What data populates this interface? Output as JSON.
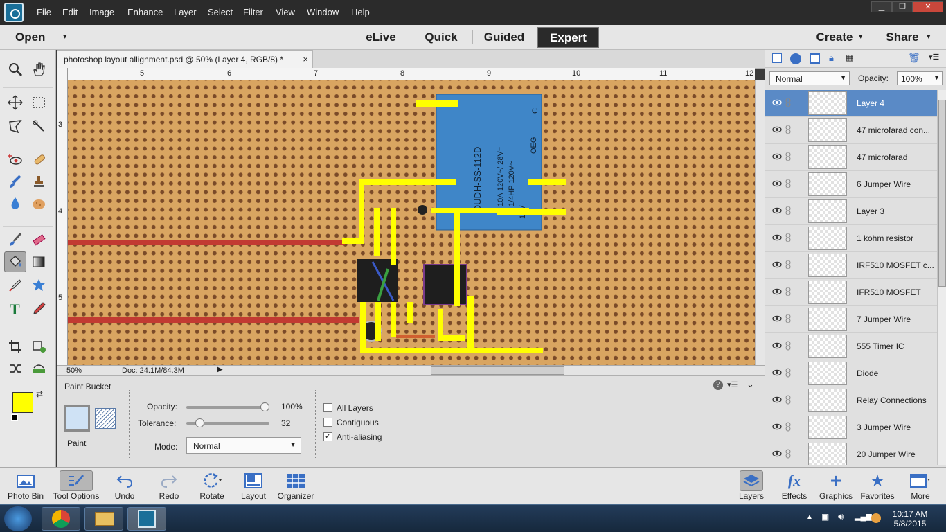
{
  "menubar": {
    "items": [
      "File",
      "Edit",
      "Image",
      "Enhance",
      "Layer",
      "Select",
      "Filter",
      "View",
      "Window",
      "Help"
    ]
  },
  "modebar": {
    "open": "Open",
    "modes": [
      "eLive",
      "Quick",
      "Guided",
      "Expert"
    ],
    "create": "Create",
    "share": "Share"
  },
  "document": {
    "tab_title": "photoshop layout allignment.psd @ 50% (Layer 4, RGB/8) *",
    "close": "×",
    "ruler_h": [
      "5",
      "6",
      "7",
      "8",
      "9",
      "10",
      "11",
      "12"
    ],
    "ruler_v": [
      "3",
      "4",
      "5"
    ],
    "zoom": "50%",
    "doc_size": "Doc: 24.1M/84.3M"
  },
  "tool_options": {
    "tool_name": "Paint Bucket",
    "paint_label": "Paint",
    "opacity_label": "Opacity:",
    "opacity_value": "100%",
    "opacity_level": 1.0,
    "tolerance_label": "Tolerance:",
    "tolerance_value": "32",
    "tolerance_level": 0.125,
    "mode_label": "Mode:",
    "mode_value": "Normal",
    "all_layers": "All Layers",
    "contiguous": "Contiguous",
    "anti_aliasing": "Anti-aliasing",
    "anti_aliasing_checked": true,
    "fg_color": "#ffff00",
    "bg_color": "#ffffff"
  },
  "layers_panel": {
    "blend_mode": "Normal",
    "opacity_label": "Opacity:",
    "opacity_value": "100%",
    "layers": [
      {
        "name": "Layer 4",
        "selected": true
      },
      {
        "name": "47 microfarad con...",
        "selected": false
      },
      {
        "name": "47 microfarad",
        "selected": false
      },
      {
        "name": "6 Jumper Wire",
        "selected": false
      },
      {
        "name": "Layer 3",
        "selected": false
      },
      {
        "name": "1 kohm resistor",
        "selected": false
      },
      {
        "name": "IRF510 MOSFET c...",
        "selected": false
      },
      {
        "name": "IFR510 MOSFET",
        "selected": false
      },
      {
        "name": "7 Jumper Wire",
        "selected": false
      },
      {
        "name": "555 Timer IC",
        "selected": false
      },
      {
        "name": "Diode",
        "selected": false
      },
      {
        "name": "Relay Connections",
        "selected": false
      },
      {
        "name": "3 Jumper Wire",
        "selected": false
      },
      {
        "name": "20 Jumper Wire",
        "selected": false
      }
    ]
  },
  "relay": {
    "text1": "OUDH-SS-112D",
    "text2": "10A 120V~/ 28V=",
    "text3": "1/4HP 120V~",
    "text4": "12V",
    "text5": "OEG",
    "text6": "C"
  },
  "bottombar": {
    "left": [
      "Photo Bin",
      "Tool Options",
      "Undo",
      "Redo",
      "Rotate",
      "Layout",
      "Organizer"
    ],
    "right": [
      "Layers",
      "Effects",
      "Graphics",
      "Favorites",
      "More"
    ]
  },
  "taskbar": {
    "time": "10:17 AM",
    "date": "5/8/2015"
  },
  "colors": {
    "accent_selected_layer": "#5a8ac6",
    "board": "#d9a561",
    "highlight": "#ffff00",
    "relay": "#3f86c8"
  }
}
